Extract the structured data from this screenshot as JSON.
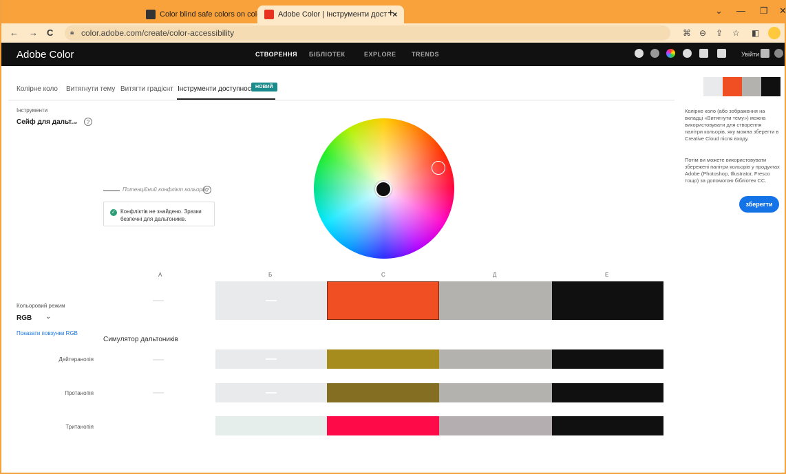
{
  "browser": {
    "tabs": [
      {
        "title": "Color blind safe colors on color v",
        "close": "×"
      },
      {
        "title": "Adobe Color | Інструменти дост",
        "close": "×"
      }
    ],
    "new_tab": "+",
    "url": "color.adobe.com/create/color-accessibility",
    "back": "←",
    "forward": "→",
    "reload": "C"
  },
  "app": {
    "logo": "Adobe Color",
    "nav": [
      "СТВОРЕННЯ",
      "БІБЛІОТЕК",
      "EXPLORE",
      "TRENDS"
    ],
    "signin": "Увійти"
  },
  "subtabs": [
    "Колірне коло",
    "Витягнути тему",
    "Витягти градієнт",
    "Інструменти доступності"
  ],
  "new_badge": "НОВИЙ",
  "tools": {
    "label": "Інструменти",
    "selected": "Сейф для дальт...",
    "legend": "Потенційний конфлікт кольорів",
    "ok_message_line1": "Конфліктів не знайдено. Зразки",
    "ok_message_line2": "безпечні для дальтоників."
  },
  "swatches": {
    "labels": [
      "A",
      "Б",
      "C",
      "Д",
      "E"
    ],
    "colors": [
      "#E8EAEC",
      "#F04E23",
      "#B4B2AF",
      "#101010"
    ]
  },
  "color_mode": {
    "label": "Кольоровий режим",
    "value": "RGB",
    "show_sliders": "Показати повзунки RGB"
  },
  "simulator": {
    "title": "Симулятор дальтоників",
    "rows": [
      {
        "label": "Дейтеранопія",
        "colors": [
          "#E8EAEC",
          "#A68C1C",
          "#B4B2AF",
          "#101010"
        ]
      },
      {
        "label": "Протанопія",
        "colors": [
          "#E8EAEC",
          "#836E22",
          "#B4B2AF",
          "#101010"
        ]
      },
      {
        "label": "Тританопія",
        "colors": [
          "#E6EEEC",
          "#FF0A48",
          "#B5AEB0",
          "#101010"
        ]
      }
    ]
  },
  "right_panel": {
    "palette": [
      "#E8EAEC",
      "#F04E23",
      "#B4B2AF",
      "#101010"
    ],
    "text1_lines": [
      "Колірне коло (або зображення на",
      "вкладці «Витягнути тему») можна",
      "використовувати для створення",
      "палітри кольорів, яку можна зберегти в",
      "Creative Cloud після входу."
    ],
    "text2_lines": [
      "Потім ви можете використовувати",
      "збережені палітри кольорів у продуктах",
      "Adobe (Photoshop, Illustrator, Fresco",
      "тощо) за допомогою бібліотек CC."
    ],
    "save": "зберегти"
  }
}
